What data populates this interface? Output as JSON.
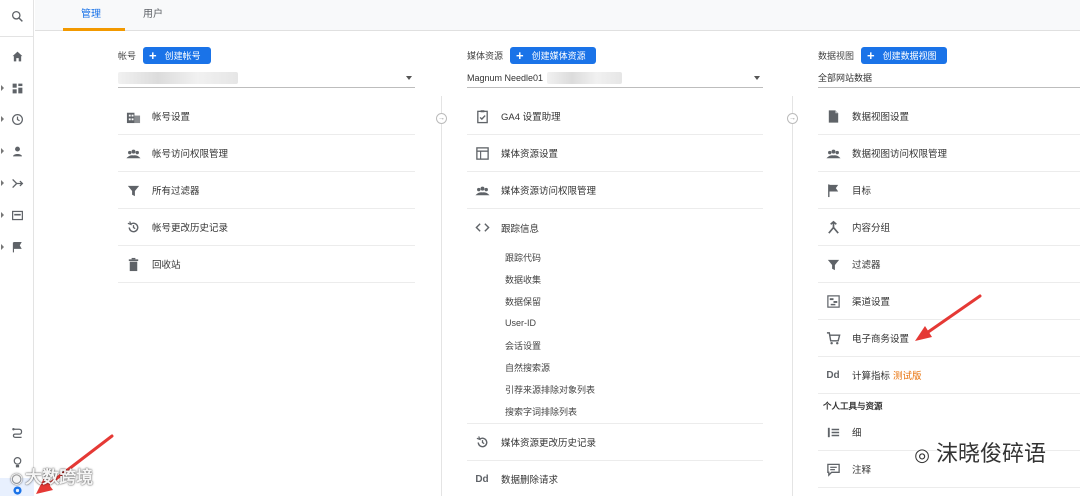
{
  "tabs": [
    {
      "label": "管理",
      "active": true
    },
    {
      "label": "用户",
      "active": false
    }
  ],
  "rail_icons": [
    "search-icon",
    "home-icon",
    "dashboard-icon",
    "clock-icon",
    "person-icon",
    "acquisition-icon",
    "behavior-icon",
    "flag-icon",
    "connect-icon",
    "lightbulb-icon",
    "gear-icon"
  ],
  "account": {
    "label": "帐号",
    "create_button": "创建帐号",
    "items": [
      {
        "icon": "building-icon",
        "label": "帐号设置"
      },
      {
        "icon": "people-icon",
        "label": "帐号访问权限管理"
      },
      {
        "icon": "filter-icon",
        "label": "所有过滤器"
      },
      {
        "icon": "history-icon",
        "label": "帐号更改历史记录"
      },
      {
        "icon": "trash-icon",
        "label": "回收站"
      }
    ]
  },
  "property": {
    "label": "媒体资源",
    "create_button": "创建媒体资源",
    "selected": "Magnum Needle01",
    "items": [
      {
        "icon": "checklist-icon",
        "label": "GA4 设置助理"
      },
      {
        "icon": "window-icon",
        "label": "媒体资源设置"
      },
      {
        "icon": "people-icon",
        "label": "媒体资源访问权限管理"
      },
      {
        "icon": "code-icon",
        "label": "跟踪信息"
      }
    ],
    "tracking_sub": [
      "跟踪代码",
      "数据收集",
      "数据保留",
      "User-ID",
      "会话设置",
      "自然搜索源",
      "引荐来源排除对象列表",
      "搜索字词排除列表"
    ],
    "items_after": [
      {
        "icon": "history-icon",
        "label": "媒体资源更改历史记录"
      },
      {
        "icon": "dd-icon",
        "label": "数据删除请求"
      }
    ]
  },
  "view": {
    "label": "数据视图",
    "create_button": "创建数据视图",
    "selected": "全部网站数据",
    "items": [
      {
        "icon": "document-icon",
        "label": "数据视图设置"
      },
      {
        "icon": "people-icon",
        "label": "数据视图访问权限管理"
      },
      {
        "icon": "flag-icon",
        "label": "目标"
      },
      {
        "icon": "content-group-icon",
        "label": "内容分组"
      },
      {
        "icon": "filter-icon",
        "label": "过滤器"
      },
      {
        "icon": "channel-icon",
        "label": "渠道设置"
      },
      {
        "icon": "cart-icon",
        "label": "电子商务设置"
      }
    ],
    "calc_metric": {
      "icon": "dd-icon",
      "label": "计算指标",
      "badge": "测试版"
    },
    "section_title": "个人工具与资源",
    "personal_items": [
      {
        "icon": "segment-icon",
        "label": "细"
      },
      {
        "icon": "comment-icon",
        "label": "注释"
      }
    ]
  },
  "watermarks": {
    "right": "沫晓俊碎语",
    "left": "大数跨境"
  },
  "colors": {
    "accent": "#1a73e8",
    "tab_underline": "#f29900",
    "beta": "#e8710a",
    "arrow": "#e53935"
  }
}
